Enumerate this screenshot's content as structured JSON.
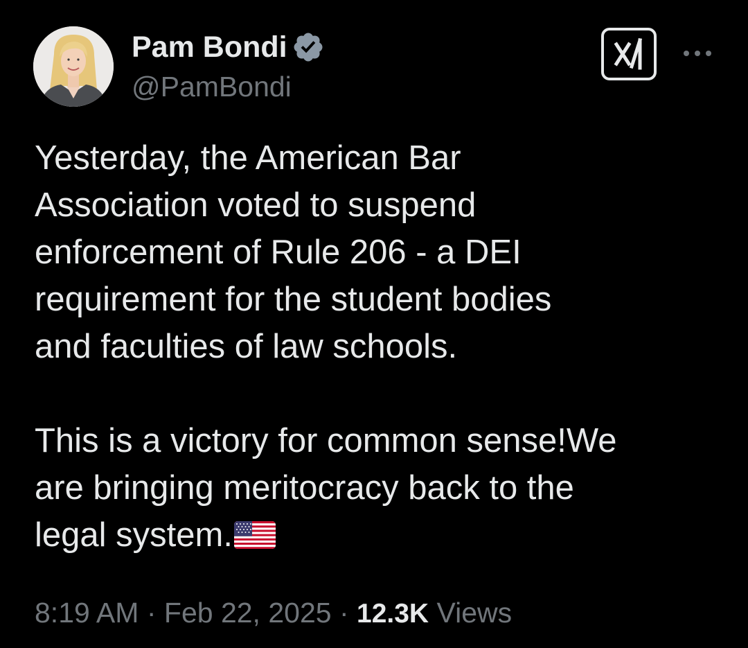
{
  "author": {
    "display_name": "Pam Bondi",
    "handle": "@PamBondi",
    "verified": true,
    "verified_badge_color": "#8b98a5",
    "avatar_icon": "profile-photo"
  },
  "header_actions": {
    "grok_icon": "grok-icon",
    "more_icon": "more-icon"
  },
  "tweet": {
    "paragraph_1": "Yesterday, the American Bar\nAssociation voted to suspend\nenforcement of Rule 206 - a DEI\nrequirement for the student bodies\nand faculties of law schools.",
    "paragraph_2": "This is a victory for common sense!We\nare bringing meritocracy back to the\nlegal system.",
    "emoji": "us-flag-emoji"
  },
  "meta": {
    "time": "8:19 AM",
    "separator": "·",
    "date": "Feb 22, 2025",
    "views_count": "12.3K",
    "views_label": "Views"
  },
  "colors": {
    "background": "#000000",
    "primary_text": "#e7e9ea",
    "secondary_text": "#71767b"
  }
}
